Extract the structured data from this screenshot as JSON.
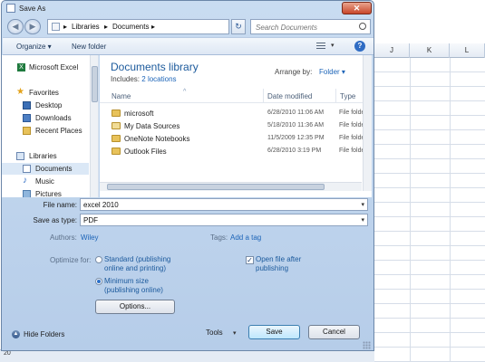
{
  "window": {
    "title": "Save As",
    "close_glyph": "✕"
  },
  "address": {
    "crumbs": [
      "Libraries",
      "Documents"
    ],
    "separator": "▸",
    "search_placeholder": "Search Documents"
  },
  "toolbar": {
    "organize": "Organize ▾",
    "new_folder": "New folder",
    "views_dd": "▾",
    "help": "?"
  },
  "nav": {
    "items": [
      {
        "label": "Microsoft Excel",
        "icon": "excel-icon"
      },
      {
        "label": "Favorites",
        "icon": "star-icon"
      },
      {
        "label": "Desktop",
        "icon": "desktop-icon"
      },
      {
        "label": "Downloads",
        "icon": "downloads-icon"
      },
      {
        "label": "Recent Places",
        "icon": "recent-places-icon"
      },
      {
        "label": "Libraries",
        "icon": "libraries-icon"
      },
      {
        "label": "Documents",
        "icon": "documents-icon"
      },
      {
        "label": "Music",
        "icon": "music-icon"
      },
      {
        "label": "Pictures",
        "icon": "pictures-icon"
      }
    ]
  },
  "library": {
    "title": "Documents library",
    "includes_label": "Includes:",
    "includes_link": "2 locations",
    "arrange_label": "Arrange by:",
    "arrange_value": "Folder ▾"
  },
  "columns": {
    "name": "Name",
    "date": "Date modified",
    "type": "Type"
  },
  "files": [
    {
      "name": "microsoft",
      "date": "6/28/2010 11:06 AM",
      "type": "File folder"
    },
    {
      "name": "My Data Sources",
      "date": "5/18/2010 11:36 AM",
      "type": "File folder"
    },
    {
      "name": "OneNote Notebooks",
      "date": "11/5/2009 12:35 PM",
      "type": "File folder"
    },
    {
      "name": "Outlook Files",
      "date": "6/28/2010 3:19 PM",
      "type": "File folder"
    }
  ],
  "form": {
    "file_name_label": "File name:",
    "file_name_value": "excel 2010",
    "save_as_type_label": "Save as type:",
    "save_as_type_value": "PDF",
    "authors_label": "Authors:",
    "authors_value": "Wiley",
    "tags_label": "Tags:",
    "tags_value": "Add a tag",
    "optimize_label": "Optimize for:",
    "opt_standard": "Standard (publishing online and printing)",
    "opt_minimum": "Minimum size (publishing online)",
    "open_after_publish": "Open file after publishing",
    "open_after_publish_checked": true,
    "options_button": "Options..."
  },
  "footer": {
    "hide_folders": "Hide Folders",
    "tools": "Tools",
    "save": "Save",
    "cancel": "Cancel"
  },
  "excel": {
    "columns": [
      "J",
      "K",
      "L"
    ],
    "row_number": "20"
  },
  "colors": {
    "accent": "#1c5a9c",
    "link": "#1c64b8",
    "dialog_frame": "#b6cde9"
  }
}
